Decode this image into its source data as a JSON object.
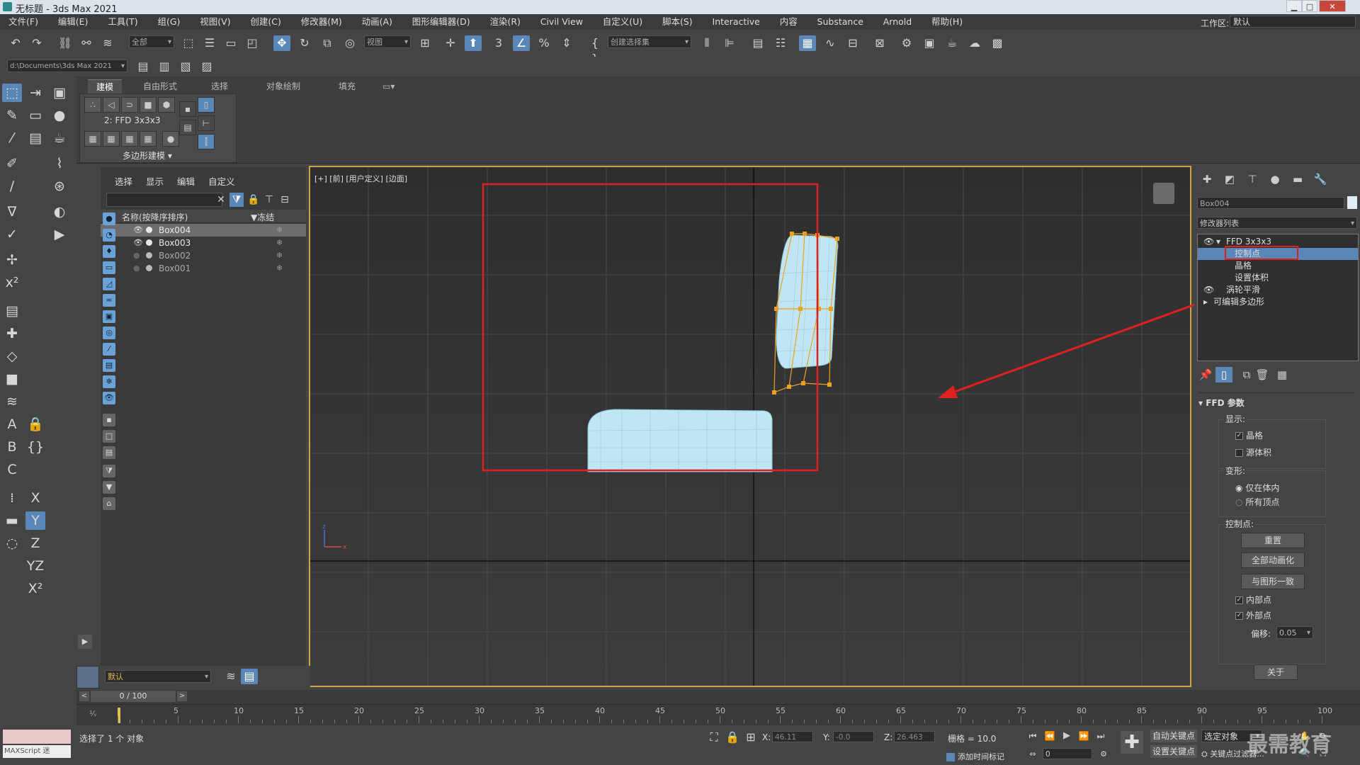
{
  "window": {
    "title": "无标题 - 3ds Max 2021",
    "minimize": "▁",
    "maximize": "□",
    "close": "✕"
  },
  "menu": [
    "文件(F)",
    "编辑(E)",
    "工具(T)",
    "组(G)",
    "视图(V)",
    "创建(C)",
    "修改器(M)",
    "动画(A)",
    "图形编辑器(D)",
    "渲染(R)",
    "Civil View",
    "自定义(U)",
    "脚本(S)",
    "Interactive",
    "内容",
    "Substance",
    "Arnold",
    "帮助(H)"
  ],
  "workspace": {
    "label": "工作区:",
    "value": "默认"
  },
  "toolbar": {
    "selection_filter": "全部",
    "ref_coord": "视图",
    "named_sel": "创建选择集"
  },
  "pathbar": {
    "path": "d:\\Documents\\3ds Max 2021"
  },
  "ribbon": {
    "tabs": [
      "建模",
      "自由形式",
      "选择",
      "对象绘制",
      "填充"
    ],
    "active_tab": "建模",
    "object_label": "2: FFD 3x3x3",
    "panel_label": "多边形建模 ▾"
  },
  "explorer": {
    "tabs": [
      "选择",
      "显示",
      "编辑",
      "自定义"
    ],
    "col_name": "名称(按降序排序)",
    "col_frozen": "▼冻结",
    "rows": [
      {
        "name": "Box004",
        "visible": true
      },
      {
        "name": "Box003",
        "visible": true
      },
      {
        "name": "Box002",
        "visible": false
      },
      {
        "name": "Box001",
        "visible": false
      }
    ],
    "layer": "默认"
  },
  "viewport": {
    "label": "[+] [前] [用户定义] [边面]"
  },
  "command_panel": {
    "object_name": "Box004",
    "modifier_list": "修改器列表",
    "stack": [
      {
        "label": "FFD 3x3x3",
        "level": 0
      },
      {
        "label": "控制点",
        "level": 1,
        "selected": true
      },
      {
        "label": "晶格",
        "level": 1
      },
      {
        "label": "设置体积",
        "level": 1
      },
      {
        "label": "涡轮平滑",
        "level": 0
      },
      {
        "label": "可编辑多边形",
        "level": 0
      }
    ],
    "rollout_title": "FFD 参数",
    "display_label": "显示:",
    "display_lattice": "晶格",
    "display_source_volume": "源体积",
    "deform_label": "变形:",
    "deform_inside": "仅在体内",
    "deform_all": "所有顶点",
    "cp_label": "控制点:",
    "btn_reset": "重置",
    "btn_animate_all": "全部动画化",
    "btn_conform": "与图形一致",
    "inside_points": "内部点",
    "outside_points": "外部点",
    "offset_label": "偏移:",
    "offset_value": "0.05",
    "btn_about": "关于"
  },
  "timeline": {
    "frame_display": "0 / 100",
    "ticks": [
      5,
      10,
      15,
      20,
      25,
      30,
      35,
      40,
      45,
      50,
      55,
      60,
      65,
      70,
      75,
      80,
      85,
      90,
      95,
      100
    ]
  },
  "status": {
    "maxscript": "MAXScript 迷",
    "selected": "选择了 1 个 对象",
    "x_label": "X:",
    "x": "46.11",
    "y_label": "Y:",
    "y": "-0.0",
    "z_label": "Z:",
    "z": "26.463",
    "grid": "栅格 = 10.0",
    "add_time_tag": "添加时间标记",
    "auto_key": "自动关键点",
    "set_key": "设置关键点",
    "selected_obj": "选定对象",
    "key_filters": "关键点过滤器...",
    "frame": "0"
  },
  "watermark": "最需教育",
  "colors": {
    "accent": "#5b87b8",
    "highlight": "#e02020",
    "mesh": "#bfe6f2",
    "lattice": "#f0a020"
  }
}
